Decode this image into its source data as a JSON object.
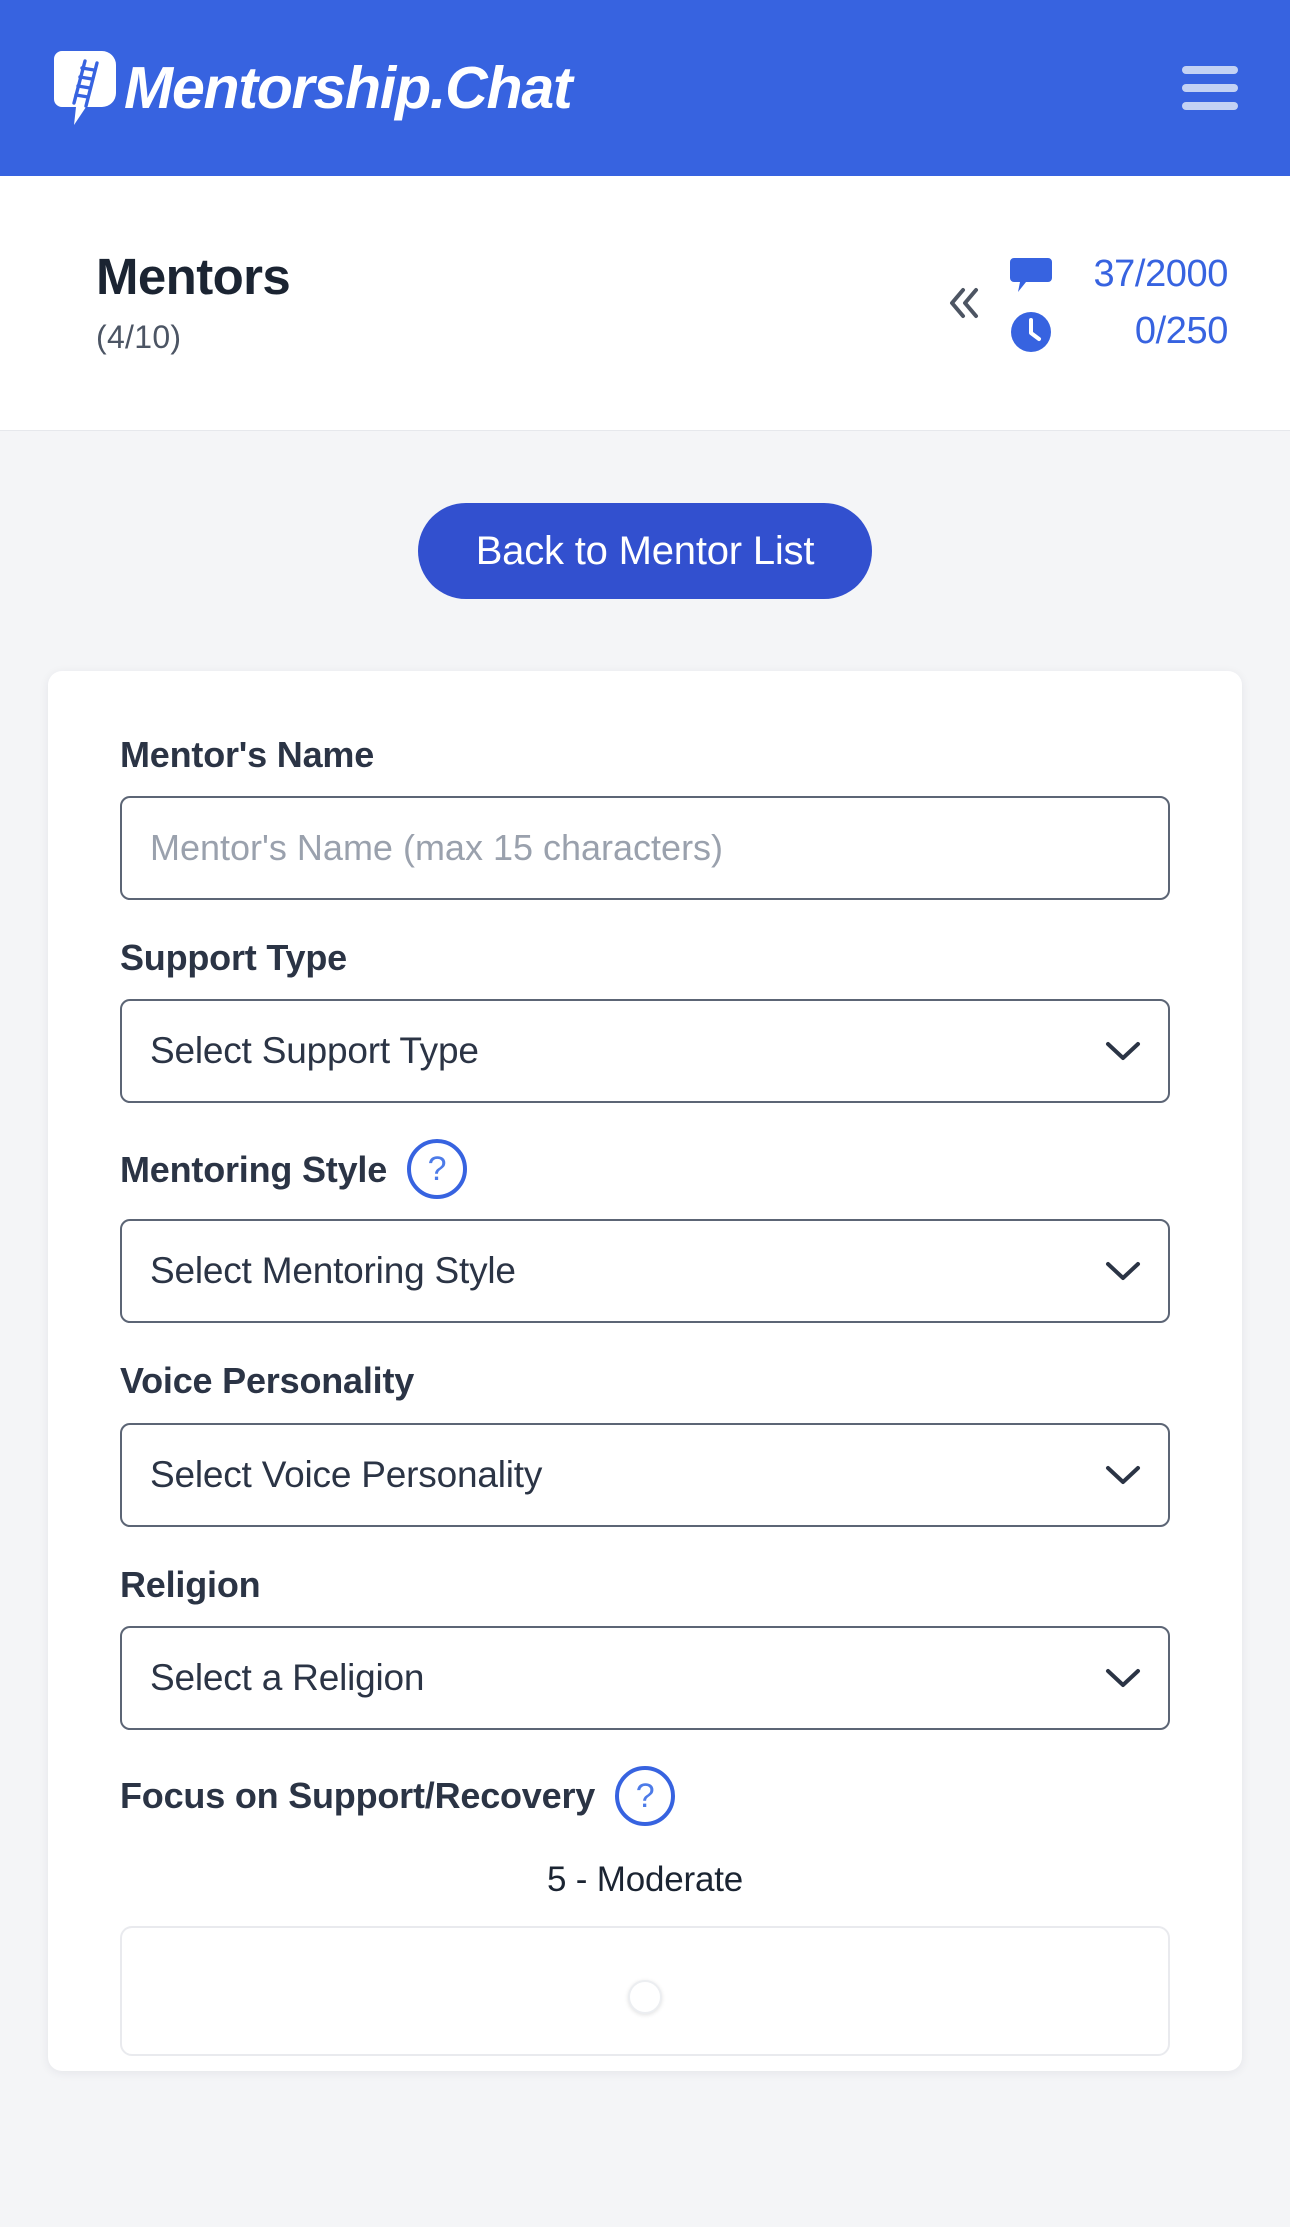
{
  "brand": {
    "name": "Mentorship.Chat",
    "logo_icon": "speech-bubble-ladder-icon",
    "menu_icon": "hamburger-menu-icon"
  },
  "colors": {
    "header_blue": "#3763e0",
    "button_blue": "#3250cf",
    "accent_blue": "#3763e0",
    "page_background": "#f4f5f7",
    "card_background": "#ffffff",
    "text_dark": "#1b2432",
    "border_gray": "#5c6575",
    "placeholder_gray": "#9aa1ad"
  },
  "header": {
    "title": "Mentors",
    "count": "(4/10)",
    "collapse_icon": "double-chevron-left-icon",
    "stats": [
      {
        "icon": "chat-bubble-icon",
        "value": "37/2000"
      },
      {
        "icon": "clock-icon",
        "value": "0/250"
      }
    ]
  },
  "actions": {
    "back_label": "Back to Mentor List"
  },
  "form": {
    "name_field": {
      "label": "Mentor's Name",
      "placeholder": "Mentor's Name (max 15 characters)",
      "value": ""
    },
    "support_type": {
      "label": "Support Type",
      "selected": "Select Support Type"
    },
    "mentoring_style": {
      "label": "Mentoring Style",
      "help": "?",
      "selected": "Select Mentoring Style"
    },
    "voice_personality": {
      "label": "Voice Personality",
      "selected": "Select Voice Personality"
    },
    "religion": {
      "label": "Religion",
      "selected": "Select a Religion"
    },
    "focus_slider": {
      "label": "Focus on Support/Recovery",
      "help": "?",
      "value_label": "5 - Moderate",
      "value": 5,
      "min": 1,
      "max": 10
    }
  }
}
